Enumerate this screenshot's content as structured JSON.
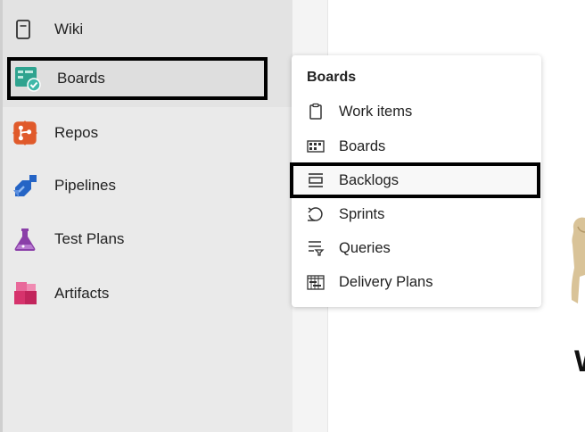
{
  "sidebar": {
    "items": [
      {
        "label": "Wiki",
        "icon": "wiki-icon"
      },
      {
        "label": "Boards",
        "icon": "boards-icon",
        "selected": true
      },
      {
        "label": "Repos",
        "icon": "repos-icon"
      },
      {
        "label": "Pipelines",
        "icon": "pipelines-icon"
      },
      {
        "label": "Test Plans",
        "icon": "test-plans-icon"
      },
      {
        "label": "Artifacts",
        "icon": "artifacts-icon"
      }
    ]
  },
  "flyout": {
    "title": "Boards",
    "items": [
      {
        "label": "Work items",
        "icon": "work-items-icon"
      },
      {
        "label": "Boards",
        "icon": "boards-grid-icon"
      },
      {
        "label": "Backlogs",
        "icon": "backlogs-icon",
        "highlighted": true
      },
      {
        "label": "Sprints",
        "icon": "sprints-icon"
      },
      {
        "label": "Queries",
        "icon": "queries-icon"
      },
      {
        "label": "Delivery Plans",
        "icon": "delivery-plans-icon"
      }
    ]
  },
  "colors": {
    "boards_teal": "#2fa38f",
    "boards_check": "#3fb8a9",
    "repos_orange": "#e05a2b",
    "pipelines_blue": "#2564c5",
    "test_plans_purple": "#8a3fa8",
    "artifacts_pink": "#d6336c",
    "highlight_border": "#000000"
  },
  "main": {
    "heading_fragment": "W"
  }
}
